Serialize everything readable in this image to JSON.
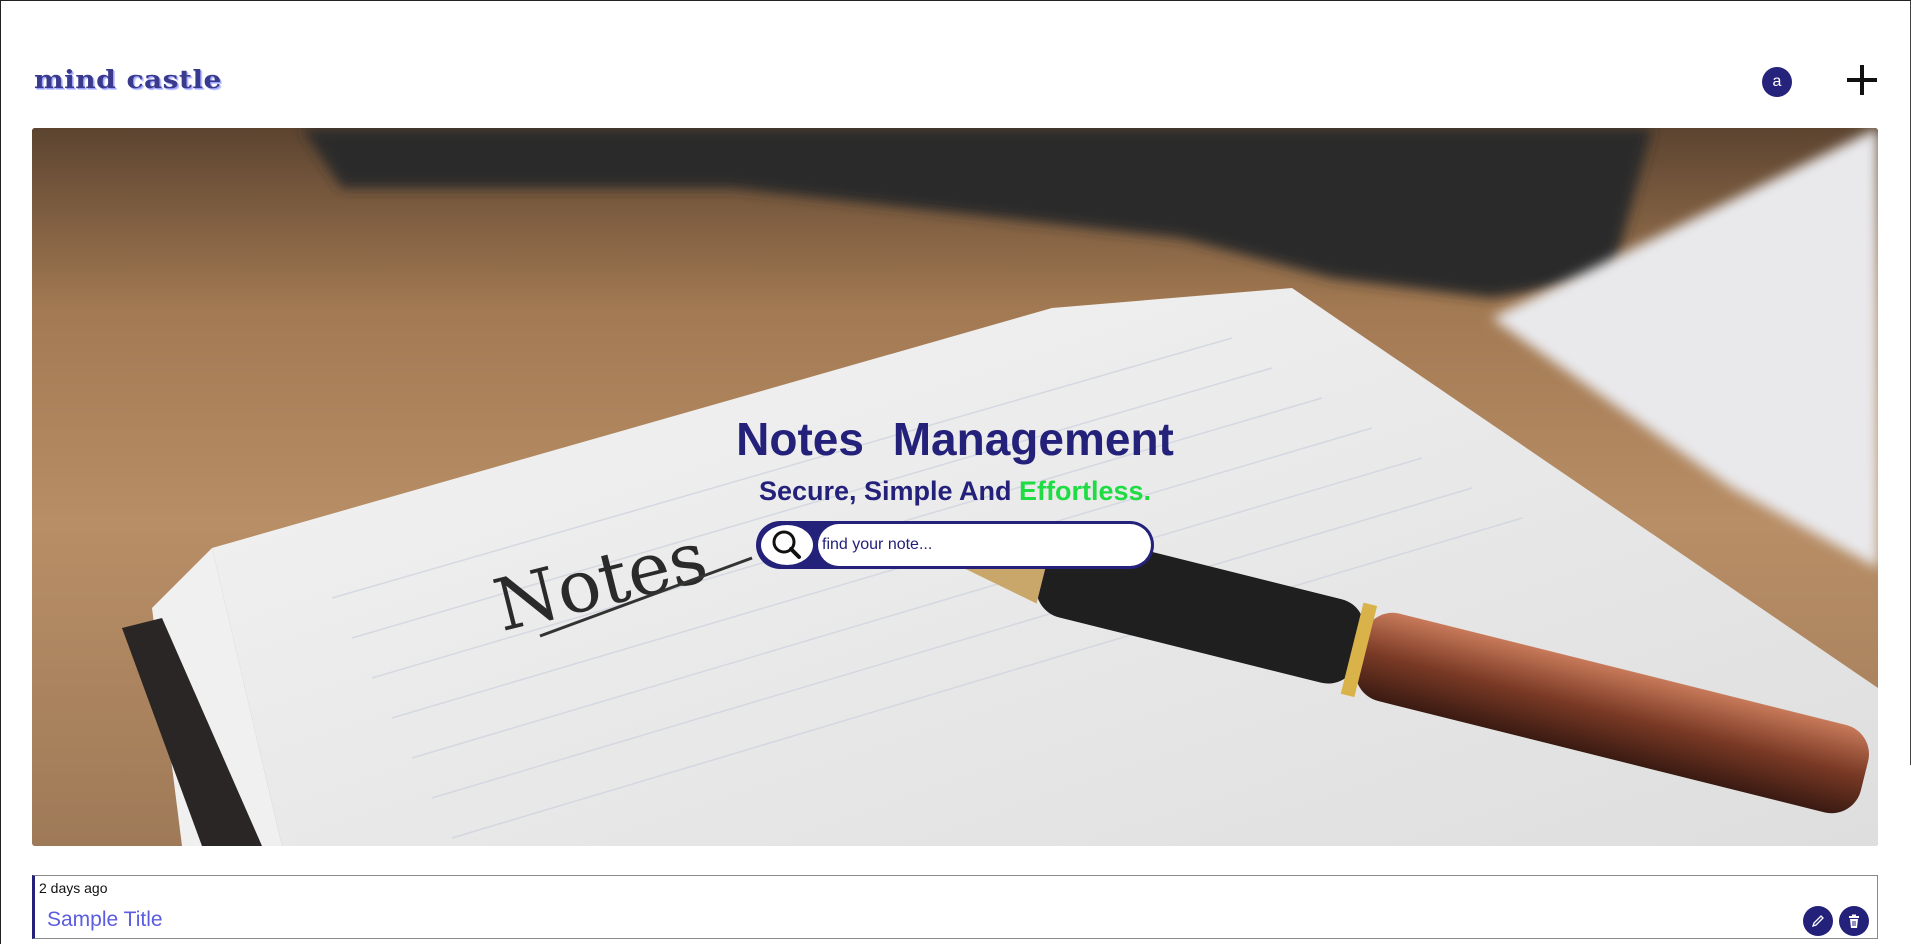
{
  "header": {
    "logo_text": "mind castle",
    "avatar_letter": "a",
    "add_icon": "plus-icon"
  },
  "hero": {
    "title": "Notes  Management",
    "subtitle_prefix": "Secure, Simple And ",
    "subtitle_accent": "Effortless.",
    "handwritten_word": "Notes",
    "search": {
      "placeholder": "find your note...",
      "icon": "search-icon"
    }
  },
  "notes": [
    {
      "time": "2 days ago",
      "title": "Sample Title",
      "actions": [
        "pencil-icon",
        "trash-icon"
      ]
    }
  ],
  "colors": {
    "primary": "#24217a",
    "accent_green": "#1fdc43",
    "note_title": "#5c5ce0",
    "logo": "#3a3a8c"
  }
}
